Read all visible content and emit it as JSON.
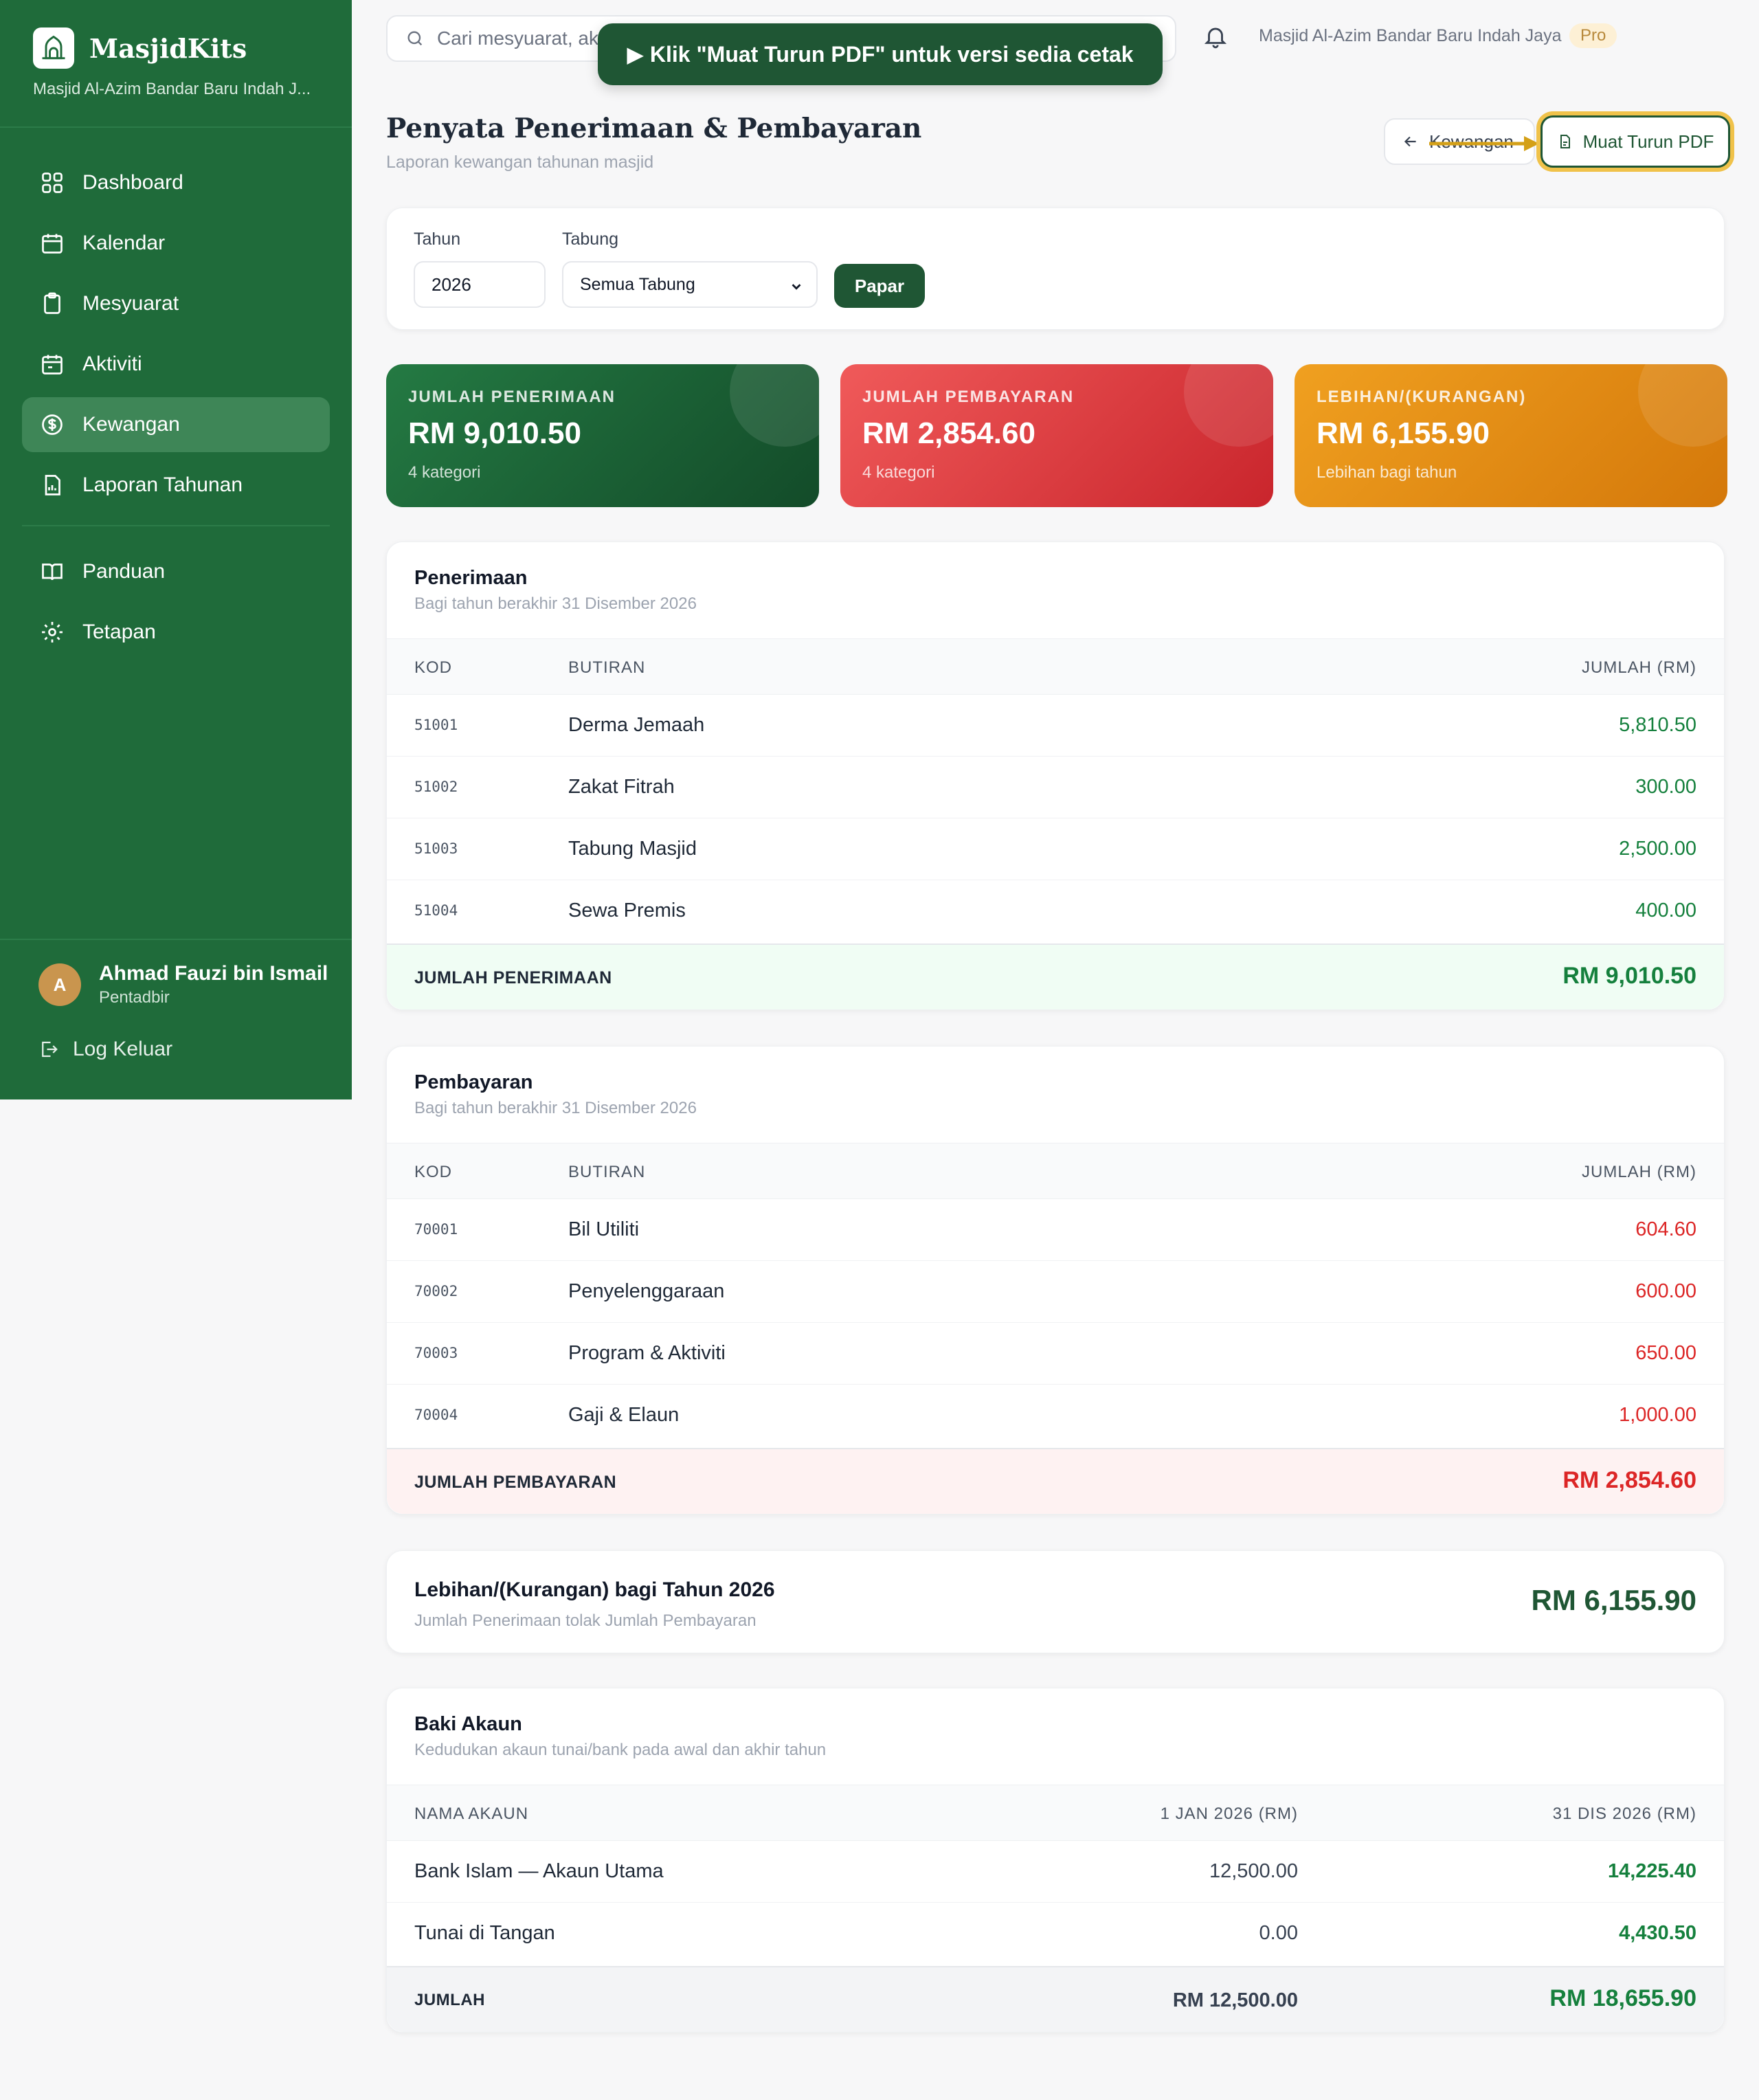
{
  "sidebar": {
    "brand_name": "MasjidKits",
    "brand_sub": "Masjid Al-Azim Bandar Baru Indah J...",
    "items": [
      {
        "label": "Dashboard"
      },
      {
        "label": "Kalendar"
      },
      {
        "label": "Mesyuarat"
      },
      {
        "label": "Aktiviti"
      },
      {
        "label": "Kewangan"
      },
      {
        "label": "Laporan Tahunan"
      },
      {
        "label": "Panduan"
      },
      {
        "label": "Tetapan"
      }
    ],
    "user": {
      "initial": "A",
      "name": "Ahmad Fauzi bin Ismail",
      "role": "Pentadbir"
    },
    "logout_label": "Log Keluar"
  },
  "topbar": {
    "search_placeholder": "Cari mesyuarat, ak",
    "masjid_name": "Masjid Al-Azim Bandar Baru Indah Jaya",
    "badge": "Pro",
    "tooltip": "▶ Klik \"Muat Turun PDF\" untuk versi sedia cetak"
  },
  "header": {
    "title": "Penyata Penerimaan & Pembayaran",
    "subtitle": "Laporan kewangan tahunan masjid",
    "back_label": "Kewangan",
    "pdf_label": "Muat Turun PDF"
  },
  "filters": {
    "year_label": "Tahun",
    "year_value": "2026",
    "fund_label": "Tabung",
    "fund_value": "Semua Tabung",
    "submit_label": "Papar"
  },
  "stats": [
    {
      "label": "JUMLAH PENERIMAAN",
      "value": "RM 9,010.50",
      "sub": "4 kategori"
    },
    {
      "label": "JUMLAH PEMBAYARAN",
      "value": "RM 2,854.60",
      "sub": "4 kategori"
    },
    {
      "label": "LEBIHAN/(KURANGAN)",
      "value": "RM 6,155.90",
      "sub": "Lebihan bagi tahun"
    }
  ],
  "receipts": {
    "title": "Penerimaan",
    "subtitle": "Bagi tahun berakhir 31 Disember 2026",
    "headers": {
      "code": "KOD",
      "desc": "BUTIRAN",
      "amount": "JUMLAH (RM)"
    },
    "rows": [
      {
        "code": "51001",
        "desc": "Derma Jemaah",
        "amount": "5,810.50"
      },
      {
        "code": "51002",
        "desc": "Zakat Fitrah",
        "amount": "300.00"
      },
      {
        "code": "51003",
        "desc": "Tabung Masjid",
        "amount": "2,500.00"
      },
      {
        "code": "51004",
        "desc": "Sewa Premis",
        "amount": "400.00"
      }
    ],
    "total_label": "JUMLAH PENERIMAAN",
    "total_value": "RM 9,010.50"
  },
  "payments": {
    "title": "Pembayaran",
    "subtitle": "Bagi tahun berakhir 31 Disember 2026",
    "headers": {
      "code": "KOD",
      "desc": "BUTIRAN",
      "amount": "JUMLAH (RM)"
    },
    "rows": [
      {
        "code": "70001",
        "desc": "Bil Utiliti",
        "amount": "604.60"
      },
      {
        "code": "70002",
        "desc": "Penyelenggaraan",
        "amount": "600.00"
      },
      {
        "code": "70003",
        "desc": "Program & Aktiviti",
        "amount": "650.00"
      },
      {
        "code": "70004",
        "desc": "Gaji & Elaun",
        "amount": "1,000.00"
      }
    ],
    "total_label": "JUMLAH PEMBAYARAN",
    "total_value": "RM 2,854.60"
  },
  "surplus": {
    "title": "Lebihan/(Kurangan) bagi Tahun 2026",
    "subtitle": "Jumlah Penerimaan tolak Jumlah Pembayaran",
    "value": "RM 6,155.90"
  },
  "balances": {
    "title": "Baki Akaun",
    "subtitle": "Kedudukan akaun tunai/bank pada awal dan akhir tahun",
    "headers": {
      "name": "NAMA AKAUN",
      "start": "1 JAN 2026 (RM)",
      "end": "31 DIS 2026 (RM)"
    },
    "rows": [
      {
        "name": "Bank Islam — Akaun Utama",
        "start": "12,500.00",
        "end": "14,225.40"
      },
      {
        "name": "Tunai di Tangan",
        "start": "0.00",
        "end": "4,430.50"
      }
    ],
    "total_label": "JUMLAH",
    "total_start": "RM 12,500.00",
    "total_end": "RM 18,655.90"
  },
  "colors": {
    "sidebar": "#1f6b3a",
    "accent": "#1f5634",
    "income": "#15803d",
    "expense": "#dc2626",
    "highlight": "#f0c24a"
  }
}
